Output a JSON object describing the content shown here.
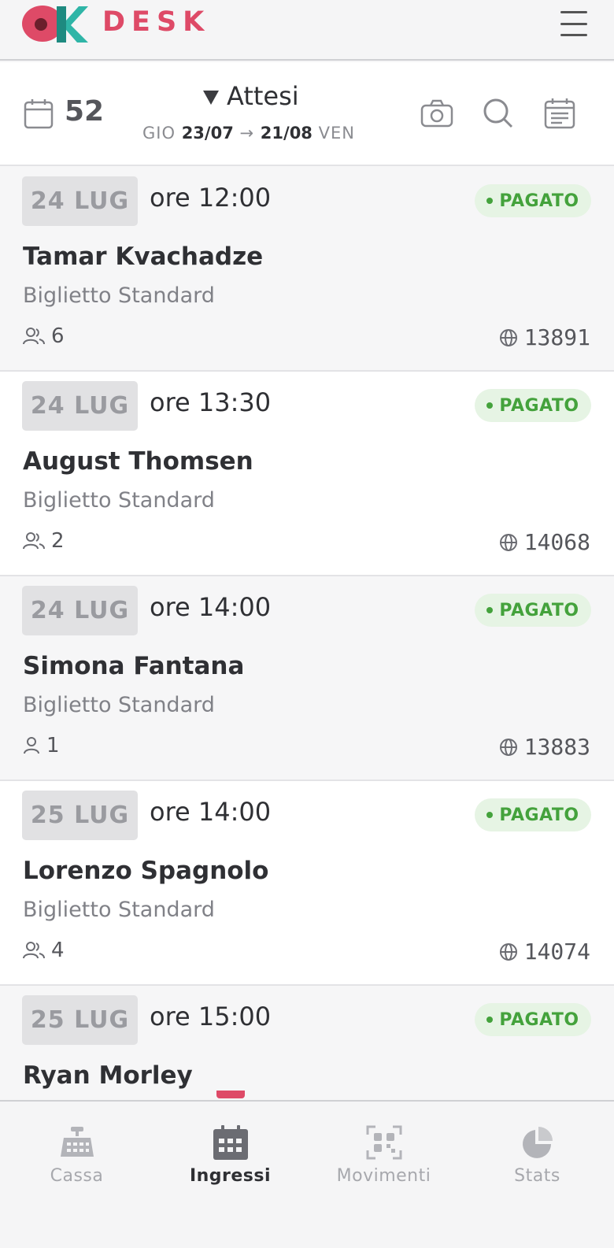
{
  "app": {
    "brand": "DESK"
  },
  "summary": {
    "count": "52",
    "filter_label": "Attesi",
    "range_start_day": "GIO",
    "range_start_date": "23/07",
    "range_arrow": "→",
    "range_end_date": "21/08",
    "range_end_day": "VEN"
  },
  "bookings": [
    {
      "date": "24 LUG",
      "time": "ore 12:00",
      "status": "PAGATO",
      "name": "Tamar Kvachadze",
      "ticket": "Biglietto Standard",
      "people": "6",
      "order": "13891"
    },
    {
      "date": "24 LUG",
      "time": "ore 13:30",
      "status": "PAGATO",
      "name": "August Thomsen",
      "ticket": "Biglietto Standard",
      "people": "2",
      "order": "14068"
    },
    {
      "date": "24 LUG",
      "time": "ore 14:00",
      "status": "PAGATO",
      "name": "Simona Fantana",
      "ticket": "Biglietto Standard",
      "people": "1",
      "order": "13883"
    },
    {
      "date": "25 LUG",
      "time": "ore 14:00",
      "status": "PAGATO",
      "name": "Lorenzo Spagnolo",
      "ticket": "Biglietto Standard",
      "people": "4",
      "order": "14074"
    },
    {
      "date": "25 LUG",
      "time": "ore 15:00",
      "status": "PAGATO",
      "name": "Ryan Morley",
      "ticket": "",
      "people": "",
      "order": ""
    }
  ],
  "nav": {
    "items": [
      {
        "label": "Cassa",
        "icon": "cash-register-icon"
      },
      {
        "label": "Ingressi",
        "icon": "calendar-icon"
      },
      {
        "label": "Movimenti",
        "icon": "qr-scan-icon"
      },
      {
        "label": "Stats",
        "icon": "pie-chart-icon"
      }
    ],
    "active": "Ingressi"
  },
  "colors": {
    "brand": "#de4a67",
    "paid_text": "#44a23c",
    "paid_bg": "#e6f4e4"
  }
}
